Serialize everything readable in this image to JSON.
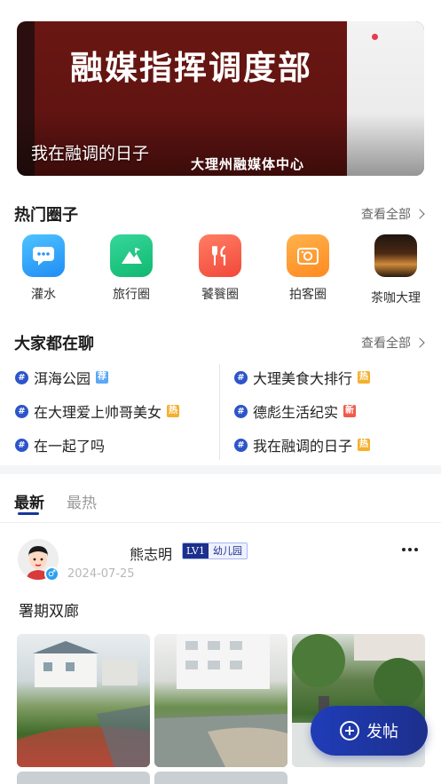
{
  "banner": {
    "sign_text": "融媒指挥调度部",
    "sub_text": "大理州融媒体中心",
    "caption": "我在融调的日子"
  },
  "hot_circles": {
    "title": "热门圈子",
    "more_label": "查看全部",
    "items": [
      {
        "label": "灌水",
        "icon": "chat-bubble-icon",
        "color": "#2a94f7"
      },
      {
        "label": "旅行圈",
        "icon": "mountain-flag-icon",
        "color": "#1fc481"
      },
      {
        "label": "饕餮圈",
        "icon": "fork-knife-icon",
        "color": "#f55b45"
      },
      {
        "label": "拍客圈",
        "icon": "camera-icon",
        "color": "#ff9a2a"
      },
      {
        "label": "茶咖大理",
        "icon": "cafe-photo-icon",
        "color": "#3a2415"
      }
    ]
  },
  "topics": {
    "title": "大家都在聊",
    "more_label": "查看全部",
    "left": [
      {
        "text": "洱海公园",
        "tag": "荐",
        "tag_type": "rec"
      },
      {
        "text": "在大理爱上帅哥美女",
        "tag": "热",
        "tag_type": "hot"
      },
      {
        "text": "在一起了吗",
        "tag": "",
        "tag_type": ""
      }
    ],
    "right": [
      {
        "text": "大理美食大排行",
        "tag": "热",
        "tag_type": "hot"
      },
      {
        "text": "德彪生活纪实",
        "tag": "新",
        "tag_type": "new"
      },
      {
        "text": "我在融调的日子",
        "tag": "热",
        "tag_type": "hot"
      }
    ]
  },
  "feed_tabs": {
    "active": "最新",
    "inactive": "最热"
  },
  "post": {
    "username": "熊志明",
    "level": "LV1",
    "level_title": "幼儿园",
    "date": "2024-07-25",
    "text": "署期双廊",
    "gender_icon": "male-icon",
    "image_count_visible": 3
  },
  "fab": {
    "label": "发帖"
  },
  "colors": {
    "brand_blue": "#1d2f8c",
    "tag_hot": "#f5b02e",
    "tag_new": "#f15a4a",
    "tag_rec": "#5aa8f7"
  }
}
